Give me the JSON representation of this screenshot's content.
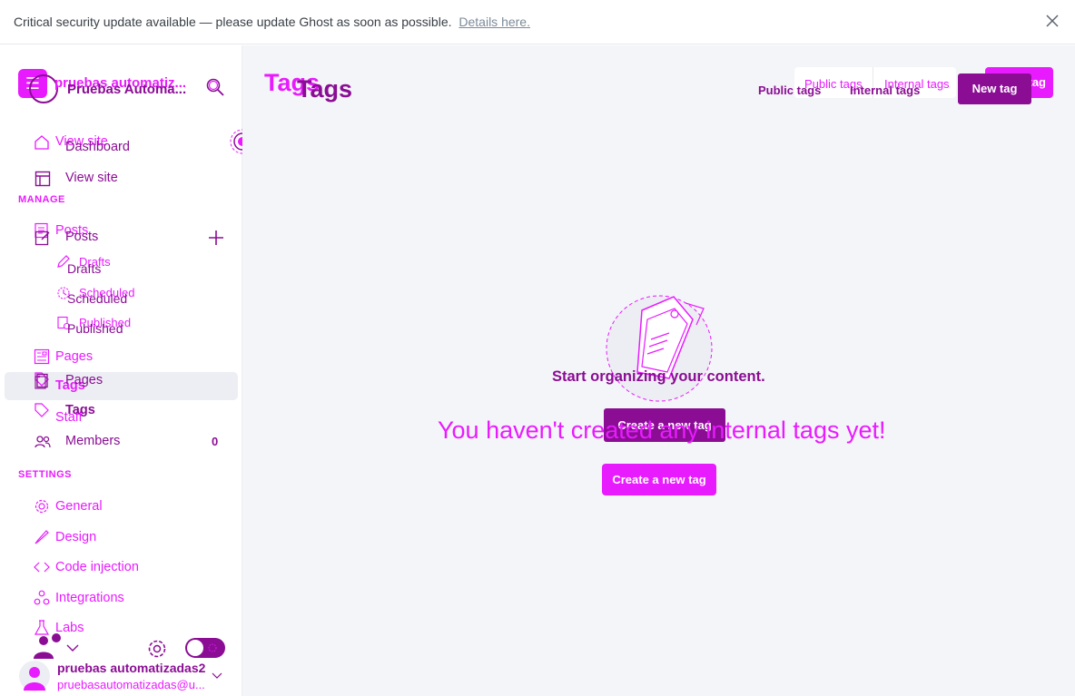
{
  "banner": {
    "text": "Critical security update available — please update Ghost as soon as possible.",
    "link": "Details here."
  },
  "brand": {
    "logo_glyph": "☰",
    "name_primary": "pruebas automatiz...",
    "name_secondary": "Pruebas Automa..."
  },
  "nav": {
    "view_site_ghost": "View site",
    "dashboard": "Dashboard",
    "view_site": "View site",
    "manage_label": "MANAGE",
    "posts_ghost": "Posts",
    "posts": "Posts",
    "drafts_ghost": "Drafts",
    "drafts": "Drafts",
    "scheduled_ghost": "Scheduled",
    "scheduled": "Scheduled",
    "published_ghost": "Published",
    "published": "Published",
    "pages_ghost": "Pages",
    "pages": "Pages",
    "tags_ghost": "Tags",
    "tags": "Tags",
    "staff_ghost": "Staff",
    "members": "Members",
    "members_count": "0",
    "settings_label": "SETTINGS",
    "general": "General",
    "design": "Design",
    "code_injection": "Code injection",
    "integrations": "Integrations",
    "labs": "Labs"
  },
  "user": {
    "name": "pruebas automatizadas2",
    "email": "pruebasautomatizadas@u..."
  },
  "header": {
    "title_ghost": "Tags",
    "title": "Tags",
    "tab_public_ghost": "Public tags",
    "tab_internal_ghost": "Internal tags",
    "tab_public": "Public tags",
    "tab_internal": "Internal tags",
    "new_tag_ghost": "New tag",
    "new_tag": "New tag"
  },
  "empty_state": {
    "heading": "Start organizing your content.",
    "cta_solid": "Create a new tag",
    "message": "You haven't created any internal tags yet!",
    "cta_ghost": "Create a new tag"
  },
  "colors": {
    "accent_dark": "#8a0d94",
    "accent_bright": "#e81bff",
    "main_bg": "#f4f5f8"
  }
}
